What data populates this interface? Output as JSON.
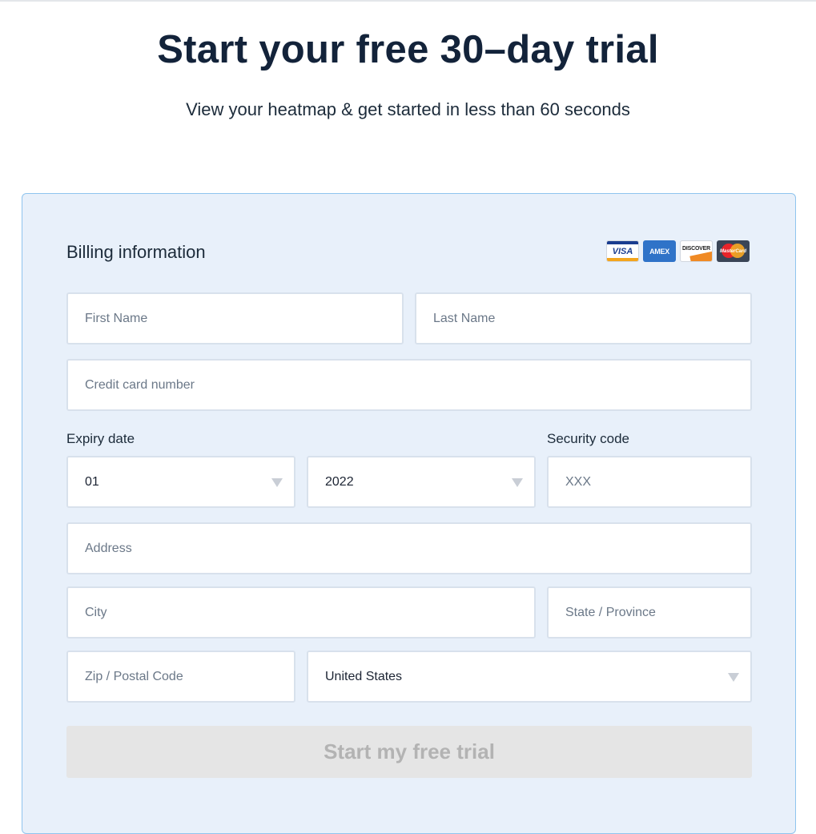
{
  "header": {
    "title": "Start your free 30–day trial",
    "subtitle": "View your heatmap & get started in less than 60 seconds"
  },
  "billing": {
    "title": "Billing information",
    "card_logos": [
      {
        "icon": "visa-icon",
        "text": "VISA"
      },
      {
        "icon": "amex-icon",
        "text": "AMEX"
      },
      {
        "icon": "discover-icon",
        "text": "DISCOVER"
      },
      {
        "icon": "mastercard-icon",
        "text": "MasterCard"
      }
    ]
  },
  "form": {
    "first_name": {
      "placeholder": "First Name"
    },
    "last_name": {
      "placeholder": "Last Name"
    },
    "card_number": {
      "placeholder": "Credit card number"
    },
    "expiry_label": "Expiry date",
    "expiry_month": {
      "value": "01"
    },
    "expiry_year": {
      "value": "2022"
    },
    "security_label": "Security code",
    "security_code": {
      "placeholder": "XXX"
    },
    "address": {
      "placeholder": "Address"
    },
    "city": {
      "placeholder": "City"
    },
    "state": {
      "placeholder": "State / Province"
    },
    "zip": {
      "placeholder": "Zip / Postal Code"
    },
    "country": {
      "value": "United States"
    },
    "submit_label": "Start my free trial"
  },
  "colors": {
    "card_background": "#e8f0fa",
    "card_border": "#8fc4ee",
    "heading_text": "#13233a",
    "disabled_button": "#e5e5e5"
  }
}
